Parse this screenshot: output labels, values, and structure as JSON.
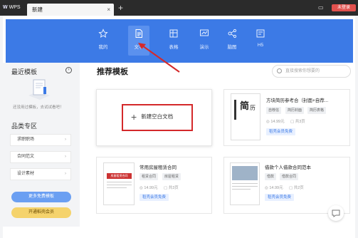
{
  "titlebar": {
    "app_name": "WPS",
    "tab_label": "新建",
    "tab_close": "×",
    "new_tab": "+",
    "badge": "未登录"
  },
  "types": [
    {
      "label": "我的",
      "icon": "star-icon"
    },
    {
      "label": "文字",
      "icon": "document-icon"
    },
    {
      "label": "表格",
      "icon": "table-icon"
    },
    {
      "label": "演示",
      "icon": "presentation-icon"
    },
    {
      "label": "脑图",
      "icon": "mindmap-icon"
    },
    {
      "label": "H5",
      "icon": "h5-icon"
    }
  ],
  "sidebar": {
    "recent_title": "最近模板",
    "recent_empty": "还没用过模板，去试试看吧！",
    "category_title": "品类专区",
    "categories": [
      "求职职场",
      "合同范文",
      "设计素材"
    ],
    "more_free": "更多免费模板",
    "vip_btn": "开通稻壳会员"
  },
  "main": {
    "heading": "推荐模板",
    "search_placeholder": "直接搜索你想要的",
    "new_blank": "新建空白文档",
    "cards": [
      {
        "title": "方块简历参考合（封面+自荐...",
        "tags": [
          "自荐信",
          "简历封面",
          "简历表格"
        ],
        "price": "14.99元",
        "pages": "共3页",
        "vip": "稻壳会员免费"
      },
      {
        "title": "常用房屋租赁合同",
        "tags": [
          "租赁合同",
          "房屋租赁"
        ],
        "price": "14.99元",
        "pages": "共3页",
        "vip": "稻壳会员免费"
      },
      {
        "title": "借款个人借款合同范本",
        "tags": [
          "借款",
          "借款合同"
        ],
        "price": "14.99元",
        "pages": "共2页",
        "vip": "稻壳会员免费"
      }
    ],
    "thumb_text": {
      "resume_big": "简",
      "resume_small": "历",
      "lease_header": "房屋租赁合同"
    }
  },
  "colors": {
    "accent": "#3c7ae6",
    "highlight": "#d4292a",
    "titlebar": "#2b2b2b"
  }
}
